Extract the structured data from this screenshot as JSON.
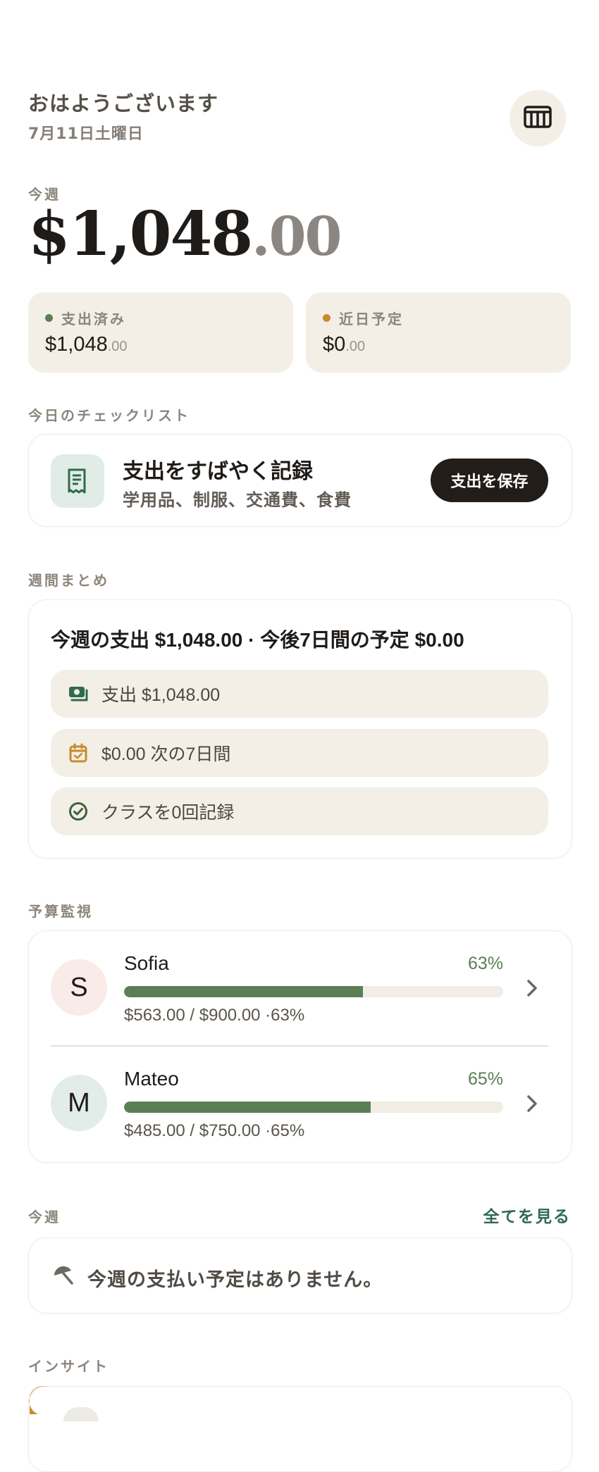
{
  "header": {
    "greeting": "おはようございます",
    "date": "7月11日土曜日",
    "calendar_icon": "calendar-grid-icon"
  },
  "week_total": {
    "label": "今週",
    "amount_main": "$1,048",
    "amount_cents": ".00"
  },
  "stats": [
    {
      "label": "支出済み",
      "value_main": "$1,048",
      "value_cents": ".00",
      "dot_color": "#5c7e57"
    },
    {
      "label": "近日予定",
      "value_main": "$0",
      "value_cents": ".00",
      "dot_color": "#c98a2e"
    }
  ],
  "checklist": {
    "section_label": "今日のチェックリスト",
    "icon": "receipt-icon",
    "title": "支出をすばやく記録",
    "subtitle": "学用品、制服、交通費、食費",
    "button": "支出を保存"
  },
  "weekly_summary": {
    "section_label": "週間まとめ",
    "headline": "今週の支出 $1,048.00 · 今後7日間の予定 $0.00",
    "pills": [
      {
        "icon": "money-icon",
        "text": "支出 $1,048.00"
      },
      {
        "icon": "calendar-check-icon",
        "text": "$0.00 次の7日間"
      },
      {
        "icon": "check-circle-icon",
        "text": "クラスを0回記録"
      }
    ]
  },
  "budget": {
    "section_label": "予算監視",
    "people": [
      {
        "initial": "S",
        "name": "Sofia",
        "percent_label": "63%",
        "progress": 0.63,
        "amount": "$563.00 / $900.00 ·63%",
        "avatar_bg": "#f8ebe8"
      },
      {
        "initial": "M",
        "name": "Mateo",
        "percent_label": "65%",
        "progress": 0.65,
        "amount": "$485.00 / $750.00 ·65%",
        "avatar_bg": "#e2ece8"
      }
    ]
  },
  "this_week": {
    "section_label": "今週",
    "see_all": "全てを見る",
    "empty_icon": "umbrella-icon",
    "empty_text": "今週の支払い予定はありません。"
  },
  "insights": {
    "section_label": "インサイト"
  },
  "colors": {
    "accent_green": "#5c7e57",
    "link_green": "#2e6b4f",
    "card_beige": "#f3efe6",
    "dark": "#231d1a"
  }
}
